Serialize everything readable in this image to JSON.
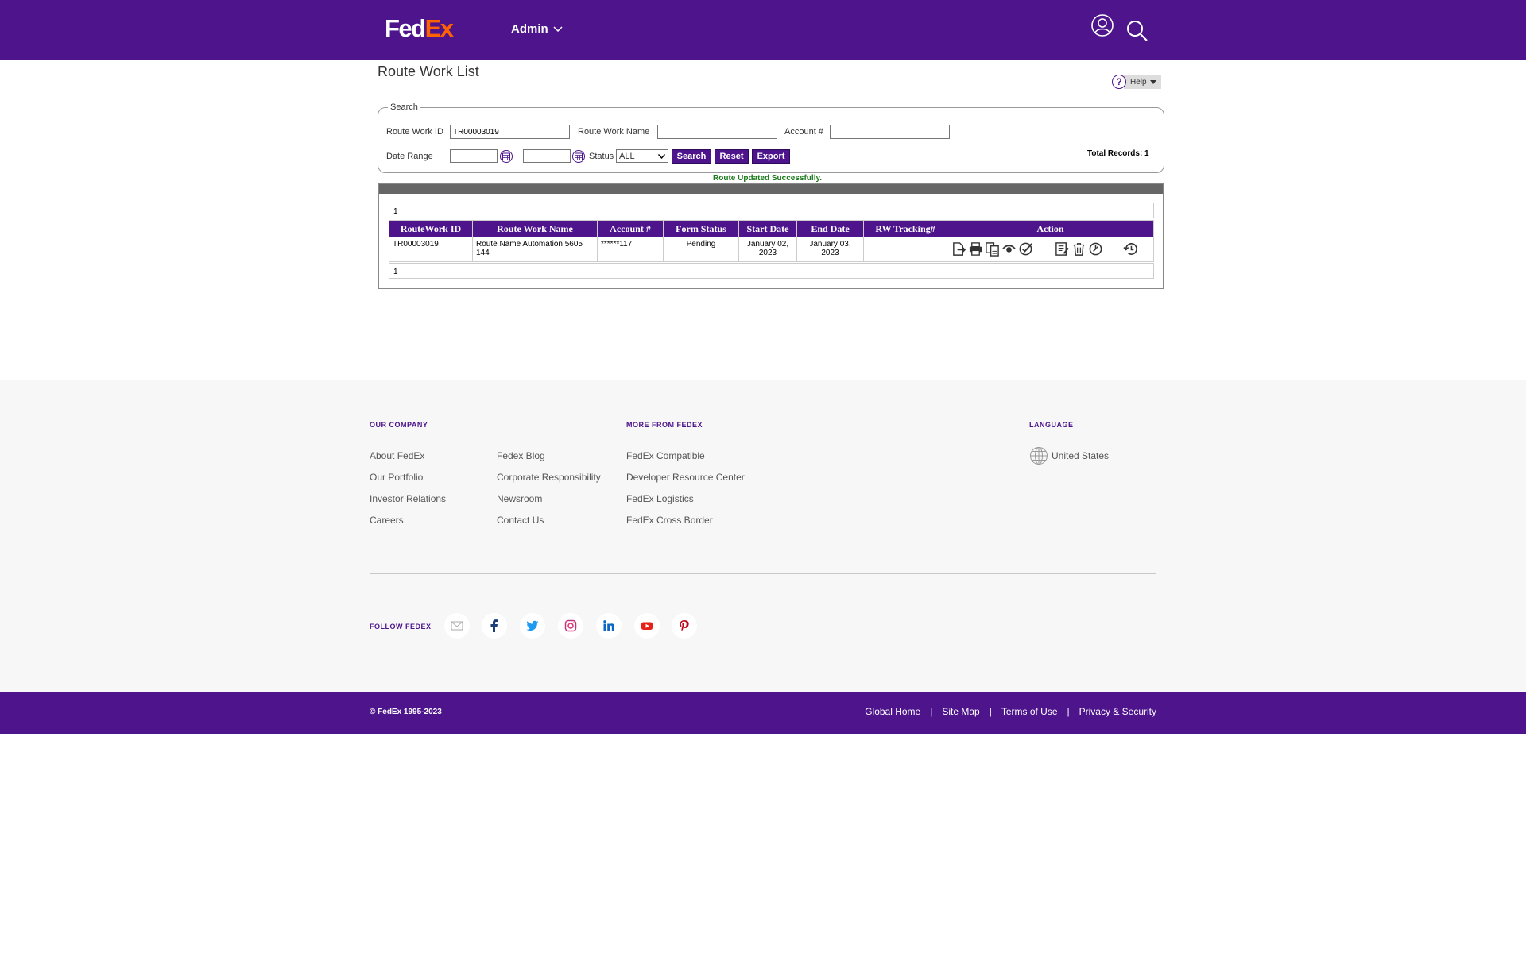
{
  "header": {
    "logo_fed": "Fed",
    "logo_ex": "Ex",
    "admin_label": "Admin"
  },
  "page": {
    "title": "Route Work List",
    "help_label": "Help"
  },
  "search": {
    "legend": "Search",
    "route_work_id_label": "Route Work ID",
    "route_work_id_value": "TR00003019",
    "route_work_name_label": "Route Work Name",
    "route_work_name_value": "",
    "account_label": "Account #",
    "account_value": "",
    "date_range_label": "Date Range",
    "status_label": "Status",
    "status_value": "ALL",
    "search_btn": "Search",
    "reset_btn": "Reset",
    "export_btn": "Export",
    "total_records": "Total Records: 1",
    "success_message": "Route Updated Successfully."
  },
  "grid": {
    "pager_top": "1",
    "pager_bottom": "1",
    "columns": [
      "RouteWork ID",
      "Route Work Name",
      "Account #",
      "Form Status",
      "Start Date",
      "End Date",
      "RW Tracking#",
      "Action"
    ],
    "rows": [
      {
        "id": "TR00003019",
        "name": "Route Name Automation 5605 144",
        "account": "******117",
        "status": "Pending",
        "start": "January 02, 2023",
        "end": "January 03, 2023",
        "tracking": ""
      }
    ],
    "action_icons": [
      "edit-export-icon",
      "print-icon",
      "copy-icon",
      "view-icon",
      "approve-icon",
      "notes-icon",
      "delete-icon",
      "timer-icon",
      "history-icon"
    ]
  },
  "footer": {
    "our_company_heading": "OUR COMPANY",
    "more_heading": "MORE FROM FEDEX",
    "language_heading": "LANGUAGE",
    "company_col1": [
      "About FedEx",
      "Our Portfolio",
      "Investor Relations",
      "Careers"
    ],
    "company_col2": [
      "Fedex Blog",
      "Corporate Responsibility",
      "Newsroom",
      "Contact Us"
    ],
    "more_links": [
      "FedEx Compatible",
      "Developer Resource Center",
      "FedEx Logistics",
      "FedEx Cross Border"
    ],
    "language_value": "United States",
    "follow_label": "FOLLOW FEDEX",
    "social_icons": [
      "email-icon",
      "facebook-icon",
      "twitter-icon",
      "instagram-icon",
      "linkedin-icon",
      "youtube-icon",
      "pinterest-icon"
    ],
    "copyright": "© FedEx 1995-2023",
    "bottom_links": [
      "Global Home",
      "Site Map",
      "Terms of Use",
      "Privacy & Security"
    ]
  },
  "colors": {
    "brand_purple": "#4d148c",
    "brand_orange": "#ff6200",
    "success_green": "#1a7a1a"
  }
}
